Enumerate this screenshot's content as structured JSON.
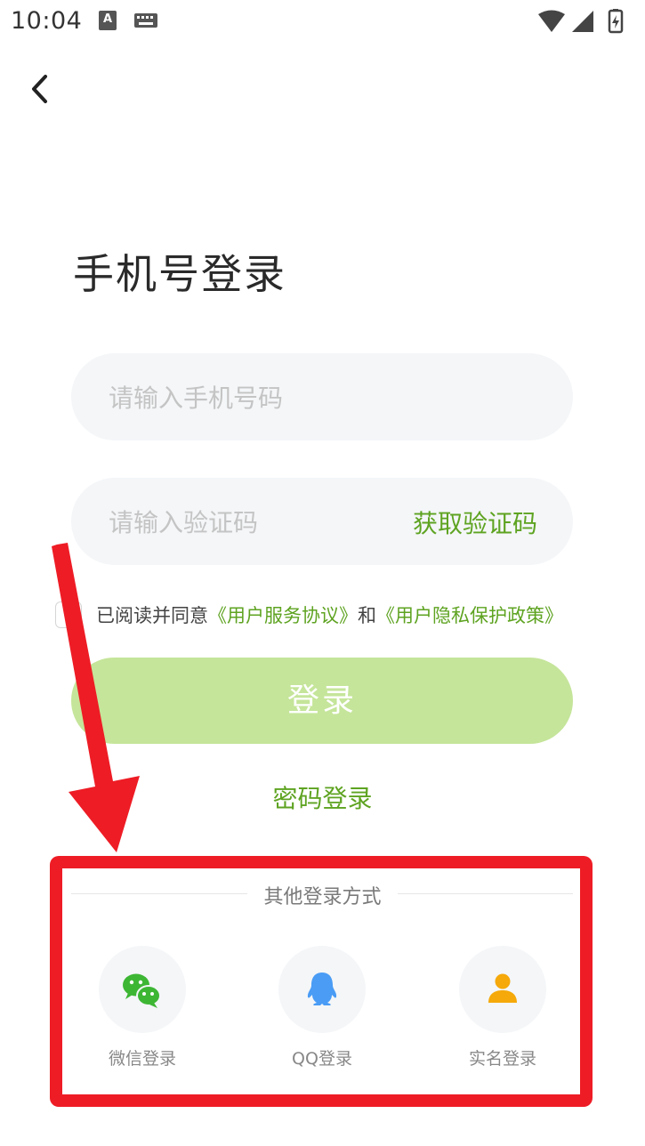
{
  "status_bar": {
    "time": "10:04",
    "input_method_label": "A"
  },
  "page": {
    "title": "手机号登录",
    "phone_placeholder": "请输入手机号码",
    "code_placeholder": "请输入验证码",
    "get_code": "获取验证码",
    "agreement": {
      "prefix": "已阅读并同意",
      "user_agreement": "《用户服务协议》",
      "conjunction": "和",
      "privacy_policy": "《用户隐私保护政策》"
    },
    "login_button": "登录",
    "password_login": "密码登录",
    "other_methods": {
      "title": "其他登录方式",
      "options": [
        {
          "label": "微信登录",
          "icon": "wechat-icon"
        },
        {
          "label": "QQ登录",
          "icon": "qq-icon"
        },
        {
          "label": "实名登录",
          "icon": "user-icon"
        }
      ]
    }
  },
  "colors": {
    "accent_green": "#5ea321",
    "button_disabled_green": "#c5e59a",
    "input_bg": "#f4f6f8",
    "annotation_red": "#ee1c25",
    "qq_blue": "#4a9cf5",
    "user_orange": "#f5a90a"
  }
}
